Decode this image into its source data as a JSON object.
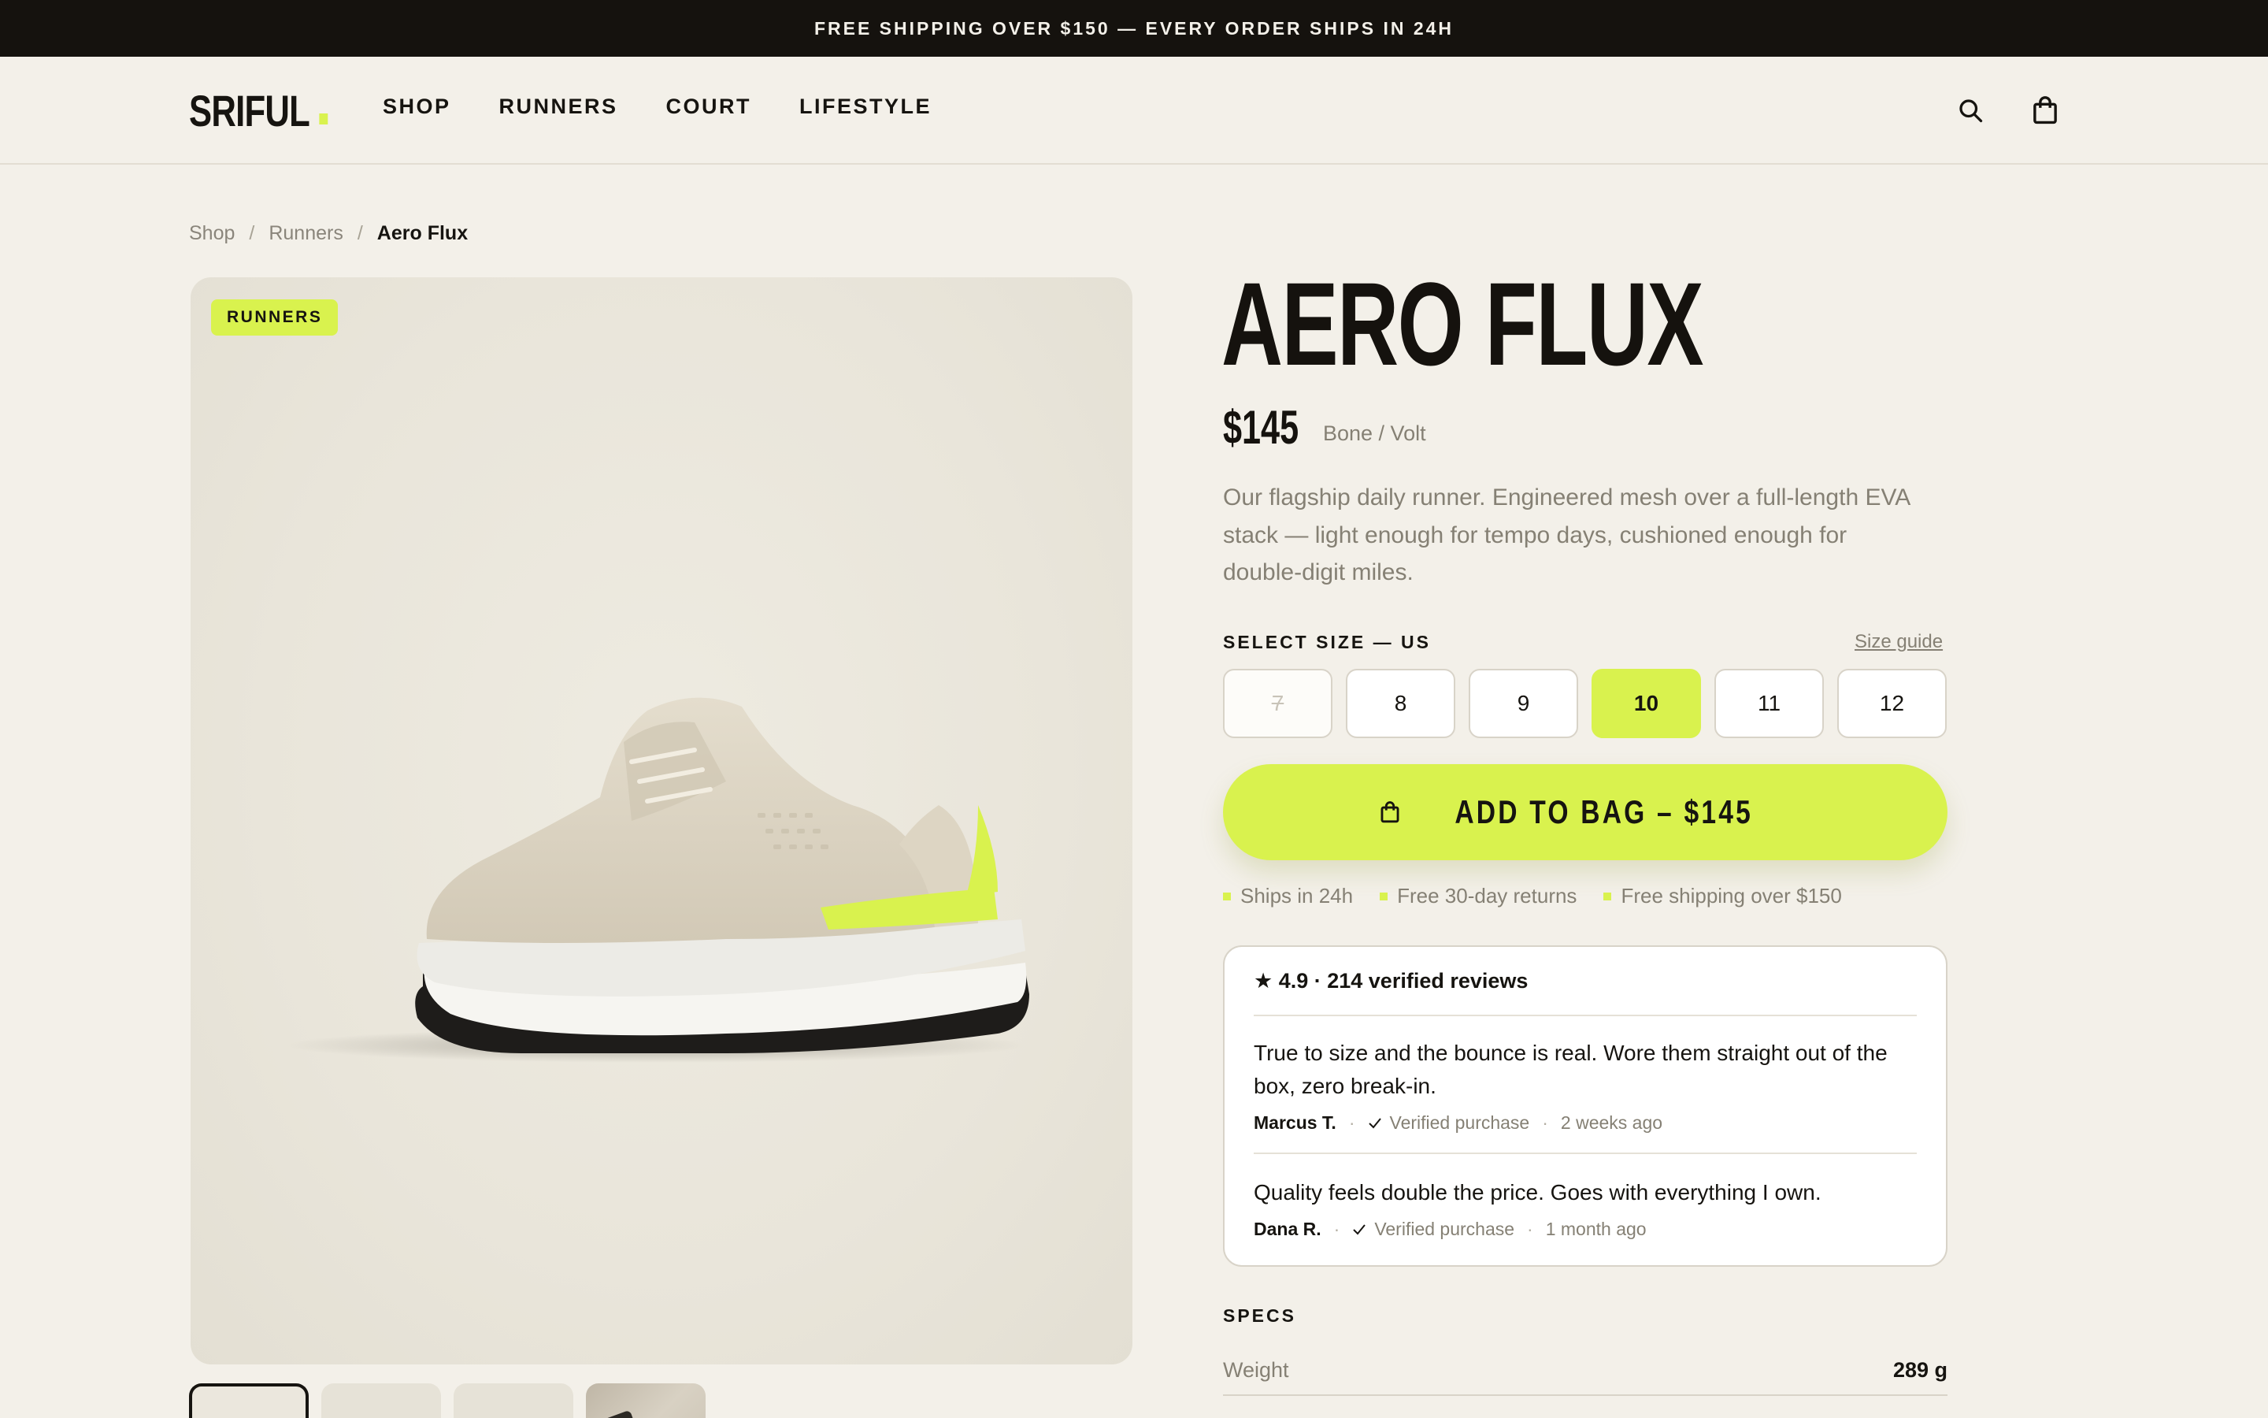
{
  "promo": {
    "text": "FREE SHIPPING OVER $150 — EVERY ORDER SHIPS IN 24H"
  },
  "nav": {
    "logo": "SRIFUL",
    "items": [
      {
        "label": "SHOP"
      },
      {
        "label": "RUNNERS"
      },
      {
        "label": "COURT"
      },
      {
        "label": "LIFESTYLE"
      }
    ],
    "icons": [
      "search-icon",
      "bag-icon"
    ]
  },
  "breadcrumb": {
    "items": [
      "Shop",
      "Runners"
    ],
    "separator": "/",
    "current": "Aero Flux"
  },
  "gallery": {
    "badge": "RUNNERS",
    "thumbnail_count": 4,
    "active_thumbnail": 1
  },
  "product": {
    "name": "AERO FLUX",
    "price": "$145",
    "colorway": "Bone / Volt",
    "description": "Our flagship daily runner. Engineered mesh over a full-length EVA stack — light enough for tempo days, cushioned enough for double-digit miles."
  },
  "size": {
    "label": "SELECT SIZE — US",
    "guide_label": "Size guide",
    "options": [
      {
        "label": "7",
        "state": "unavailable"
      },
      {
        "label": "8",
        "state": "available"
      },
      {
        "label": "9",
        "state": "available"
      },
      {
        "label": "10",
        "state": "selected"
      },
      {
        "label": "11",
        "state": "available"
      },
      {
        "label": "12",
        "state": "available"
      }
    ]
  },
  "cta": {
    "label": "ADD TO BAG – $145",
    "icon": "bag-icon"
  },
  "perks": [
    "Ships in 24h",
    "Free 30-day returns",
    "Free shipping over $150"
  ],
  "reviews": {
    "summary": "★ 4.9 · 214 verified reviews",
    "items": [
      {
        "text": "True to size and the bounce is real. Wore them straight out of the box, zero break-in.",
        "author": "Marcus T.",
        "badge": "Verified purchase",
        "time": "2 weeks ago"
      },
      {
        "text": "Quality feels double the price. Goes with everything I own.",
        "author": "Dana R.",
        "badge": "Verified purchase",
        "time": "1 month ago"
      }
    ]
  },
  "specs": {
    "label": "SPECS",
    "rows": [
      {
        "name": "Weight",
        "value": "289 g"
      }
    ]
  },
  "colors": {
    "accent": "#d9f24e",
    "ink": "#15120e",
    "background": "#f3f0e9",
    "muted": "#858074"
  }
}
